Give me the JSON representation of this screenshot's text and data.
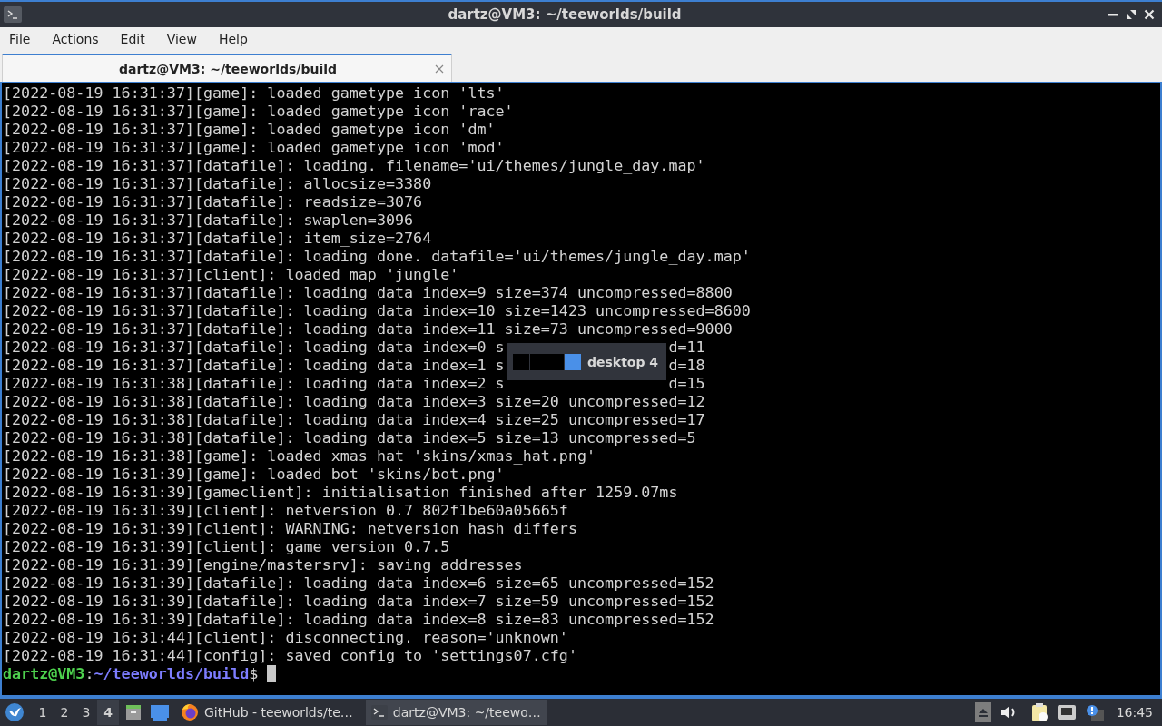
{
  "window": {
    "title": "dartz@VM3: ~/teeworlds/build"
  },
  "menu": [
    "File",
    "Actions",
    "Edit",
    "View",
    "Help"
  ],
  "tabs": [
    {
      "label": "dartz@VM3: ~/teeworlds/build",
      "selected": true
    }
  ],
  "terminal": {
    "lines": [
      {
        "text": "[2022-08-19 16:31:37][game]: loaded gametype icon 'lts'"
      },
      {
        "text": "[2022-08-19 16:31:37][game]: loaded gametype icon 'race'"
      },
      {
        "text": "[2022-08-19 16:31:37][game]: loaded gametype icon 'dm'"
      },
      {
        "text": "[2022-08-19 16:31:37][game]: loaded gametype icon 'mod'"
      },
      {
        "text": "[2022-08-19 16:31:37][datafile]: loading. filename='ui/themes/jungle_day.map'"
      },
      {
        "text": "[2022-08-19 16:31:37][datafile]: allocsize=3380"
      },
      {
        "text": "[2022-08-19 16:31:37][datafile]: readsize=3076"
      },
      {
        "text": "[2022-08-19 16:31:37][datafile]: swaplen=3096"
      },
      {
        "text": "[2022-08-19 16:31:37][datafile]: item_size=2764"
      },
      {
        "text": "[2022-08-19 16:31:37][datafile]: loading done. datafile='ui/themes/jungle_day.map'"
      },
      {
        "text": "[2022-08-19 16:31:37][client]: loaded map 'jungle'"
      },
      {
        "text": "[2022-08-19 16:31:37][datafile]: loading data index=9 size=374 uncompressed=8800"
      },
      {
        "text": "[2022-08-19 16:31:37][datafile]: loading data index=10 size=1423 uncompressed=8600"
      },
      {
        "text": "[2022-08-19 16:31:37][datafile]: loading data index=11 size=73 uncompressed=9000"
      },
      {
        "text": "[2022-08-19 16:31:37][datafile]: loading data index=0 s",
        "tail": "d=11"
      },
      {
        "text": "[2022-08-19 16:31:37][datafile]: loading data index=1 s",
        "tail": "d=18"
      },
      {
        "text": "[2022-08-19 16:31:38][datafile]: loading data index=2 s",
        "tail": "d=15"
      },
      {
        "text": "[2022-08-19 16:31:38][datafile]: loading data index=3 size=20 uncompressed=12"
      },
      {
        "text": "[2022-08-19 16:31:38][datafile]: loading data index=4 size=25 uncompressed=17"
      },
      {
        "text": "[2022-08-19 16:31:38][datafile]: loading data index=5 size=13 uncompressed=5"
      },
      {
        "text": "[2022-08-19 16:31:38][game]: loaded xmas hat 'skins/xmas_hat.png'"
      },
      {
        "text": "[2022-08-19 16:31:39][game]: loaded bot 'skins/bot.png'"
      },
      {
        "text": "[2022-08-19 16:31:39][gameclient]: initialisation finished after 1259.07ms"
      },
      {
        "text": "[2022-08-19 16:31:39][client]: netversion 0.7 802f1be60a05665f"
      },
      {
        "text": "[2022-08-19 16:31:39][client]: WARNING: netversion hash differs"
      },
      {
        "text": "[2022-08-19 16:31:39][client]: game version 0.7.5"
      },
      {
        "text": "[2022-08-19 16:31:39][engine/mastersrv]: saving addresses"
      },
      {
        "text": "[2022-08-19 16:31:39][datafile]: loading data index=6 size=65 uncompressed=152"
      },
      {
        "text": "[2022-08-19 16:31:39][datafile]: loading data index=7 size=59 uncompressed=152"
      },
      {
        "text": "[2022-08-19 16:31:39][datafile]: loading data index=8 size=83 uncompressed=152"
      },
      {
        "text": "[2022-08-19 16:31:44][client]: disconnecting. reason='unknown'"
      },
      {
        "text": "[2022-08-19 16:31:44][config]: saved config to 'settings07.cfg'"
      }
    ],
    "prompt": {
      "user_host": "dartz@VM3",
      "separator": ":",
      "path": "~/teeworlds/build",
      "symbol": "$"
    }
  },
  "desktop_popup": {
    "label": "desktop 4",
    "desktops": [
      {
        "selected": false
      },
      {
        "selected": false
      },
      {
        "selected": false
      },
      {
        "selected": true
      }
    ]
  },
  "taskbar": {
    "workspaces": [
      {
        "label": "1",
        "selected": false
      },
      {
        "label": "2",
        "selected": false
      },
      {
        "label": "3",
        "selected": false
      },
      {
        "label": "4",
        "selected": true
      }
    ],
    "tasks": [
      {
        "kind": "browser",
        "label": "GitHub - teeworlds/te…",
        "selected": false
      },
      {
        "kind": "terminal",
        "label": "dartz@VM3: ~/teewo…",
        "selected": true
      }
    ],
    "clock": "16:45"
  }
}
